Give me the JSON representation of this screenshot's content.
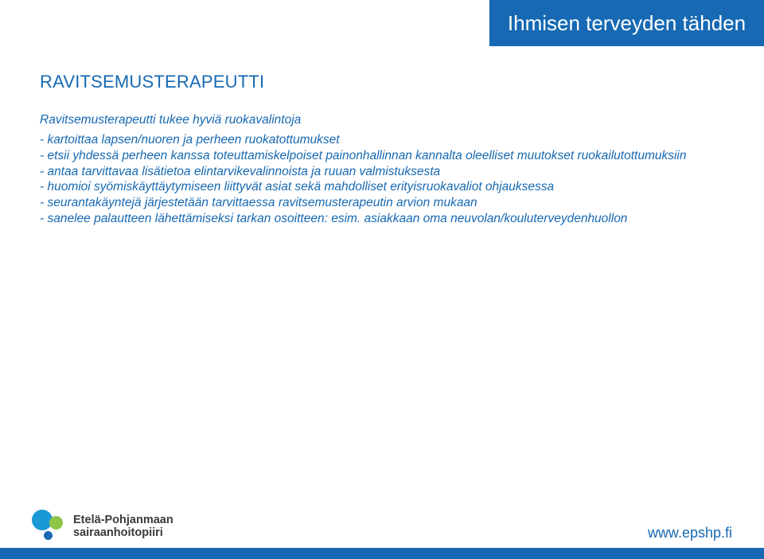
{
  "header": {
    "tagline": "Ihmisen terveyden tähden"
  },
  "content": {
    "title": "RAVITSEMUSTERAPEUTTI",
    "subtitle": "Ravitsemusterapeutti tukee hyviä ruokavalintoja",
    "bullets": [
      "- kartoittaa lapsen/nuoren ja perheen ruokatottumukset",
      "- etsii yhdessä perheen kanssa toteuttamiskelpoiset painonhallinnan kannalta oleelliset muutokset ruokailutottumuksiin",
      "- antaa tarvittavaa lisätietoa elintarvikevalinnoista ja ruuan valmistuksesta",
      "- huomioi syömiskäyttäytymiseen liittyvät asiat sekä mahdolliset erityisruokavaliot ohjauksessa",
      "- seurantakäyntejä järjestetään tarvittaessa ravitsemusterapeutin arvion mukaan",
      "- sanelee palautteen lähettämiseksi tarkan osoitteen: esim. asiakkaan oma neuvolan/kouluterveydenhuollon"
    ]
  },
  "footer": {
    "org_line1": "Etelä-Pohjanmaan",
    "org_line2": "sairaanhoitopiiri",
    "url": "www.epshp.fi"
  },
  "colors": {
    "brand_blue": "#1669b2",
    "light_blue": "#1b99d6",
    "green": "#8ec549"
  }
}
